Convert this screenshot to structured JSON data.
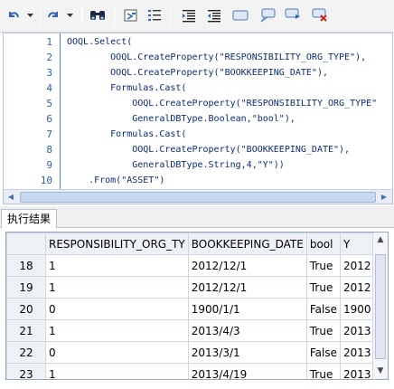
{
  "toolbar": {
    "items": [
      {
        "name": "undo-icon"
      },
      {
        "name": "undo-dropdown-icon"
      },
      {
        "name": "redo-icon"
      },
      {
        "name": "redo-dropdown-icon"
      },
      {
        "name": "find-icon"
      },
      {
        "name": "format-icon"
      },
      {
        "name": "numbered-list-icon"
      },
      {
        "name": "indent-icon"
      },
      {
        "name": "outdent-icon"
      },
      {
        "name": "comment-box-icon"
      },
      {
        "name": "speech-left-icon"
      },
      {
        "name": "speech-right-icon"
      },
      {
        "name": "clear-comment-icon"
      }
    ]
  },
  "editor": {
    "line_numbers": [
      "1",
      "2",
      "3",
      "4",
      "5",
      "6",
      "7",
      "8",
      "9",
      "10"
    ],
    "lines": [
      "OOQL.Select(",
      "        OOQL.CreateProperty(\"RESPONSIBILITY_ORG_TYPE\"),",
      "        OOQL.CreateProperty(\"BOOKKEEPING_DATE\"),",
      "        Formulas.Cast(",
      "            OOQL.CreateProperty(\"RESPONSIBILITY_ORG_TYPE\"",
      "            GeneralDBType.Boolean,\"bool\"),",
      "        Formulas.Cast(",
      "            OOQL.CreateProperty(\"BOOKKEEPING_DATE\"),",
      "            GeneralDBType.String,4,\"Y\"))",
      "    .From(\"ASSET\")"
    ]
  },
  "results": {
    "tab_label": "执行结果",
    "columns": [
      "RESPONSIBILITY_ORG_TY",
      "BOOKKEEPING_DATE",
      "bool",
      "Y"
    ],
    "rows": [
      {
        "num": "18",
        "cells": [
          "1",
          "2012/12/1",
          "True",
          "2012"
        ]
      },
      {
        "num": "19",
        "cells": [
          "1",
          "2012/12/1",
          "True",
          "2012"
        ]
      },
      {
        "num": "20",
        "cells": [
          "0",
          "1900/1/1",
          "False",
          "1900"
        ]
      },
      {
        "num": "21",
        "cells": [
          "1",
          "2013/4/3",
          "True",
          "2013"
        ]
      },
      {
        "num": "22",
        "cells": [
          "0",
          "2013/3/1",
          "False",
          "2013"
        ]
      },
      {
        "num": "23",
        "cells": [
          "1",
          "2013/4/19",
          "True",
          "2013"
        ]
      }
    ]
  }
}
